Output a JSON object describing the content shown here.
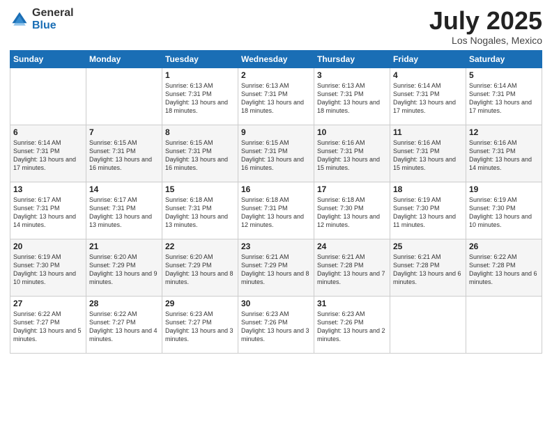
{
  "header": {
    "logo_general": "General",
    "logo_blue": "Blue",
    "month_title": "July 2025",
    "location": "Los Nogales, Mexico"
  },
  "weekdays": [
    "Sunday",
    "Monday",
    "Tuesday",
    "Wednesday",
    "Thursday",
    "Friday",
    "Saturday"
  ],
  "weeks": [
    [
      {
        "day": "",
        "info": ""
      },
      {
        "day": "",
        "info": ""
      },
      {
        "day": "1",
        "info": "Sunrise: 6:13 AM\nSunset: 7:31 PM\nDaylight: 13 hours and 18 minutes."
      },
      {
        "day": "2",
        "info": "Sunrise: 6:13 AM\nSunset: 7:31 PM\nDaylight: 13 hours and 18 minutes."
      },
      {
        "day": "3",
        "info": "Sunrise: 6:13 AM\nSunset: 7:31 PM\nDaylight: 13 hours and 18 minutes."
      },
      {
        "day": "4",
        "info": "Sunrise: 6:14 AM\nSunset: 7:31 PM\nDaylight: 13 hours and 17 minutes."
      },
      {
        "day": "5",
        "info": "Sunrise: 6:14 AM\nSunset: 7:31 PM\nDaylight: 13 hours and 17 minutes."
      }
    ],
    [
      {
        "day": "6",
        "info": "Sunrise: 6:14 AM\nSunset: 7:31 PM\nDaylight: 13 hours and 17 minutes."
      },
      {
        "day": "7",
        "info": "Sunrise: 6:15 AM\nSunset: 7:31 PM\nDaylight: 13 hours and 16 minutes."
      },
      {
        "day": "8",
        "info": "Sunrise: 6:15 AM\nSunset: 7:31 PM\nDaylight: 13 hours and 16 minutes."
      },
      {
        "day": "9",
        "info": "Sunrise: 6:15 AM\nSunset: 7:31 PM\nDaylight: 13 hours and 16 minutes."
      },
      {
        "day": "10",
        "info": "Sunrise: 6:16 AM\nSunset: 7:31 PM\nDaylight: 13 hours and 15 minutes."
      },
      {
        "day": "11",
        "info": "Sunrise: 6:16 AM\nSunset: 7:31 PM\nDaylight: 13 hours and 15 minutes."
      },
      {
        "day": "12",
        "info": "Sunrise: 6:16 AM\nSunset: 7:31 PM\nDaylight: 13 hours and 14 minutes."
      }
    ],
    [
      {
        "day": "13",
        "info": "Sunrise: 6:17 AM\nSunset: 7:31 PM\nDaylight: 13 hours and 14 minutes."
      },
      {
        "day": "14",
        "info": "Sunrise: 6:17 AM\nSunset: 7:31 PM\nDaylight: 13 hours and 13 minutes."
      },
      {
        "day": "15",
        "info": "Sunrise: 6:18 AM\nSunset: 7:31 PM\nDaylight: 13 hours and 13 minutes."
      },
      {
        "day": "16",
        "info": "Sunrise: 6:18 AM\nSunset: 7:31 PM\nDaylight: 13 hours and 12 minutes."
      },
      {
        "day": "17",
        "info": "Sunrise: 6:18 AM\nSunset: 7:30 PM\nDaylight: 13 hours and 12 minutes."
      },
      {
        "day": "18",
        "info": "Sunrise: 6:19 AM\nSunset: 7:30 PM\nDaylight: 13 hours and 11 minutes."
      },
      {
        "day": "19",
        "info": "Sunrise: 6:19 AM\nSunset: 7:30 PM\nDaylight: 13 hours and 10 minutes."
      }
    ],
    [
      {
        "day": "20",
        "info": "Sunrise: 6:19 AM\nSunset: 7:30 PM\nDaylight: 13 hours and 10 minutes."
      },
      {
        "day": "21",
        "info": "Sunrise: 6:20 AM\nSunset: 7:29 PM\nDaylight: 13 hours and 9 minutes."
      },
      {
        "day": "22",
        "info": "Sunrise: 6:20 AM\nSunset: 7:29 PM\nDaylight: 13 hours and 8 minutes."
      },
      {
        "day": "23",
        "info": "Sunrise: 6:21 AM\nSunset: 7:29 PM\nDaylight: 13 hours and 8 minutes."
      },
      {
        "day": "24",
        "info": "Sunrise: 6:21 AM\nSunset: 7:28 PM\nDaylight: 13 hours and 7 minutes."
      },
      {
        "day": "25",
        "info": "Sunrise: 6:21 AM\nSunset: 7:28 PM\nDaylight: 13 hours and 6 minutes."
      },
      {
        "day": "26",
        "info": "Sunrise: 6:22 AM\nSunset: 7:28 PM\nDaylight: 13 hours and 6 minutes."
      }
    ],
    [
      {
        "day": "27",
        "info": "Sunrise: 6:22 AM\nSunset: 7:27 PM\nDaylight: 13 hours and 5 minutes."
      },
      {
        "day": "28",
        "info": "Sunrise: 6:22 AM\nSunset: 7:27 PM\nDaylight: 13 hours and 4 minutes."
      },
      {
        "day": "29",
        "info": "Sunrise: 6:23 AM\nSunset: 7:27 PM\nDaylight: 13 hours and 3 minutes."
      },
      {
        "day": "30",
        "info": "Sunrise: 6:23 AM\nSunset: 7:26 PM\nDaylight: 13 hours and 3 minutes."
      },
      {
        "day": "31",
        "info": "Sunrise: 6:23 AM\nSunset: 7:26 PM\nDaylight: 13 hours and 2 minutes."
      },
      {
        "day": "",
        "info": ""
      },
      {
        "day": "",
        "info": ""
      }
    ]
  ]
}
